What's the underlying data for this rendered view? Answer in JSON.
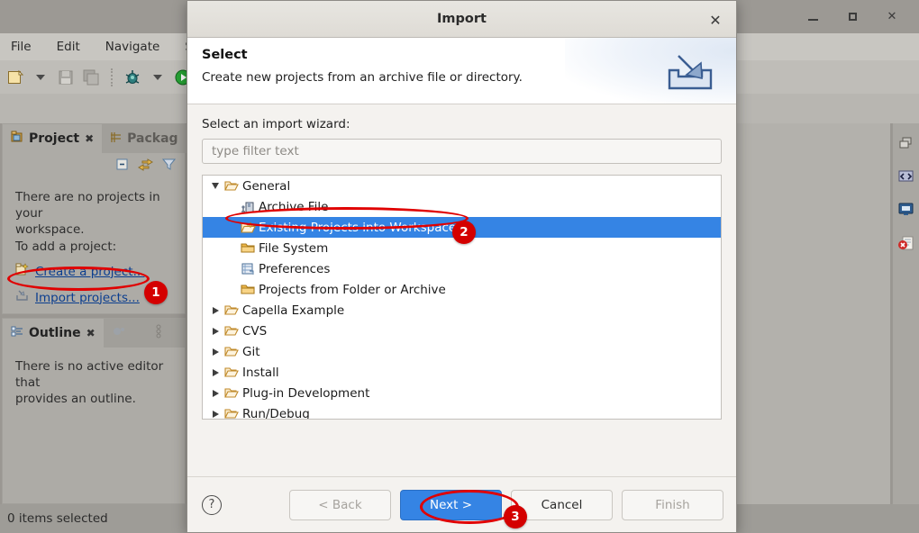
{
  "ide": {
    "menu": [
      "File",
      "Edit",
      "Navigate",
      "Search"
    ],
    "project_panel": {
      "tabs": [
        {
          "label": "Project",
          "icon": "project-explorer-icon",
          "close": "✖",
          "active": true
        },
        {
          "label": "Packag",
          "icon": "package-explorer-icon",
          "close": "",
          "active": false
        }
      ],
      "toolbar_icons": [
        "collapse-all-icon",
        "link-with-editor-icon",
        "view-menu-filter-icon"
      ],
      "message_line1": "There are no projects in your",
      "message_line2": "workspace.",
      "message_line3": "To add a project:",
      "links": [
        {
          "label": "Create a project...",
          "icon": "new-project-icon"
        },
        {
          "label": "Import projects...",
          "icon": "import-icon"
        }
      ]
    },
    "outline_panel": {
      "tabs": [
        {
          "label": "Outline",
          "icon": "outline-icon",
          "close": "✖",
          "active": true
        },
        {
          "label": "",
          "icon": "properties-icon",
          "close": "",
          "active": false
        },
        {
          "label": "",
          "icon": "progress-icon",
          "close": "",
          "active": false
        }
      ],
      "message_line1": "There is no active editor that",
      "message_line2": "provides an outline."
    },
    "right_strip_icons": [
      "restore-perspective-icon",
      "code-view-icon",
      "console-icon",
      "error-log-icon"
    ],
    "status_text": "0 items selected",
    "window_buttons": [
      "minimize",
      "maximize",
      "close"
    ]
  },
  "dialog": {
    "title": "Import",
    "close_glyph": "✕",
    "banner": {
      "heading": "Select",
      "description": "Create new projects from an archive file or directory.",
      "icon": "import-wizard-icon"
    },
    "wizard_label": "Select an import wizard:",
    "filter": {
      "value": "",
      "placeholder": "type filter text"
    },
    "tree": [
      {
        "label": "General",
        "depth": 0,
        "expander": "down",
        "icon": "folder-open-icon",
        "selected": false
      },
      {
        "label": "Archive File",
        "depth": 1,
        "expander": "none",
        "icon": "archive-file-icon",
        "selected": false
      },
      {
        "label": "Existing Projects into Workspace",
        "depth": 1,
        "expander": "none",
        "icon": "import-projects-icon",
        "selected": true
      },
      {
        "label": "File System",
        "depth": 1,
        "expander": "none",
        "icon": "folder-icon",
        "selected": false
      },
      {
        "label": "Preferences",
        "depth": 1,
        "expander": "none",
        "icon": "preferences-icon",
        "selected": false
      },
      {
        "label": "Projects from Folder or Archive",
        "depth": 1,
        "expander": "none",
        "icon": "folder-icon",
        "selected": false
      },
      {
        "label": "Capella Example",
        "depth": 0,
        "expander": "right",
        "icon": "folder-open-icon",
        "selected": false
      },
      {
        "label": "CVS",
        "depth": 0,
        "expander": "right",
        "icon": "folder-open-icon",
        "selected": false
      },
      {
        "label": "Git",
        "depth": 0,
        "expander": "right",
        "icon": "folder-open-icon",
        "selected": false
      },
      {
        "label": "Install",
        "depth": 0,
        "expander": "right",
        "icon": "folder-open-icon",
        "selected": false
      },
      {
        "label": "Plug-in Development",
        "depth": 0,
        "expander": "right",
        "icon": "folder-open-icon",
        "selected": false
      },
      {
        "label": "Run/Debug",
        "depth": 0,
        "expander": "right",
        "icon": "folder-open-icon",
        "selected": false
      }
    ],
    "help_glyph": "?",
    "buttons": [
      {
        "label": "< Back",
        "state": "disabled"
      },
      {
        "label": "Next >",
        "state": "primary"
      },
      {
        "label": "Cancel",
        "state": "normal"
      },
      {
        "label": "Finish",
        "state": "disabled"
      }
    ]
  },
  "annotations": [
    {
      "number": "1",
      "target": "import-projects-link"
    },
    {
      "number": "2",
      "target": "tree-item-existing-projects"
    },
    {
      "number": "3",
      "target": "next-button"
    }
  ],
  "colors": {
    "selection_blue": "#3584e4",
    "annotation_red": "#d40000",
    "link_blue": "#0b3e8f"
  }
}
